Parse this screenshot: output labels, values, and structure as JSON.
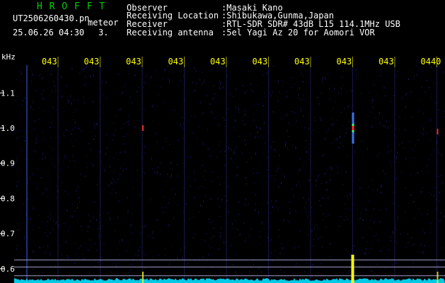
{
  "app": {
    "title": "H R O F F T"
  },
  "header": {
    "filename": "UT2506260430.pn",
    "mode": "meteor",
    "datetime": "25.06.26 04:30",
    "count": "3."
  },
  "station": {
    "observer_label": "Observer",
    "observer_value": ":Masaki Kano",
    "location_label": "Receiving Location",
    "location_value": ":Shibukawa,Gunma,Japan",
    "receiver_label": "Receiver",
    "receiver_value": ":RTL-SDR SDR# 43dB L15 114.1MHz USB",
    "antenna_label": "Receiving antenna",
    "antenna_value": ":5el Yagi Az 20 for Aomori VOR"
  },
  "axis": {
    "y_unit": "kHz",
    "y_ticks": [
      "1.1",
      "1.0",
      "0.9",
      "0.8",
      "0.7",
      "0.6"
    ],
    "x_ticks": [
      "043",
      "043",
      "043",
      "043",
      "043",
      "043",
      "043",
      "043",
      "043",
      "0440"
    ]
  },
  "colors": {
    "title": "#00d000",
    "text": "#ffffff",
    "tick_labels": "#ffff00",
    "background": "#000000",
    "noise": "#1a1a7a",
    "grid": "#2a2a8a",
    "baseline": "#00e0ff",
    "ref_lines": "#c8c8ff",
    "echo": "#ff3030"
  },
  "chart_data": {
    "type": "heatmap",
    "x_label_unit": "UTC minute (04:3x)",
    "y_unit": "kHz",
    "ylim": [
      0.56,
      1.16
    ],
    "echoes": [
      {
        "minute_index": 2.0,
        "freq_khz": 1.0,
        "strength": "weak"
      },
      {
        "minute_index": 7.0,
        "freq_khz": 1.0,
        "strength": "strong"
      },
      {
        "minute_index": 9.0,
        "freq_khz": 0.99,
        "strength": "weak"
      }
    ],
    "reference_lines_khz": [
      0.625,
      0.605,
      0.58
    ]
  }
}
